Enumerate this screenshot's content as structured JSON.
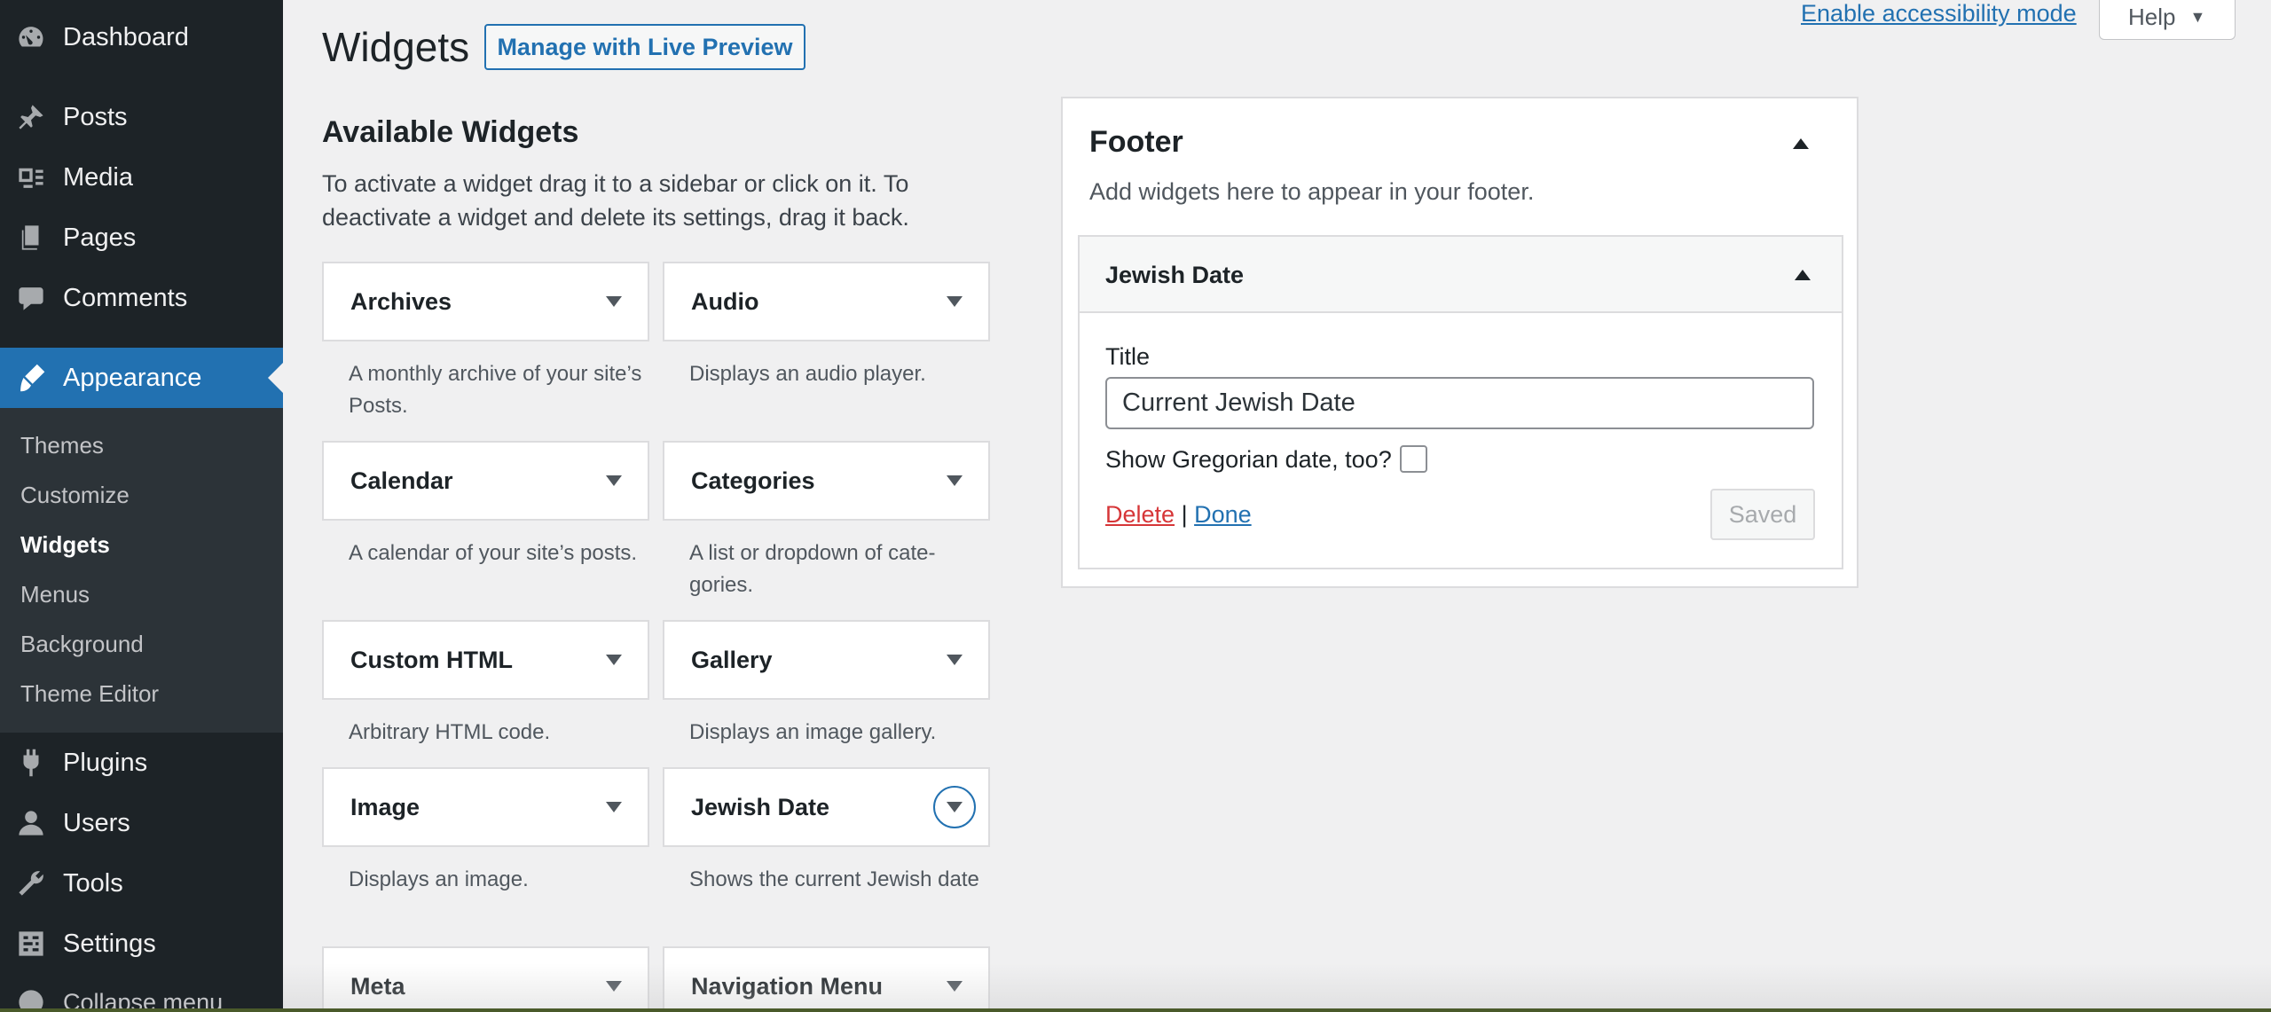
{
  "sidebar": {
    "items": [
      {
        "label": "Dashboard",
        "icon": "dashboard-icon"
      },
      {
        "label": "Posts",
        "icon": "pin-icon"
      },
      {
        "label": "Media",
        "icon": "media-icon"
      },
      {
        "label": "Pages",
        "icon": "pages-icon"
      },
      {
        "label": "Comments",
        "icon": "comments-icon"
      },
      {
        "label": "Appearance",
        "icon": "brush-icon"
      },
      {
        "label": "Plugins",
        "icon": "plugin-icon"
      },
      {
        "label": "Users",
        "icon": "users-icon"
      },
      {
        "label": "Tools",
        "icon": "wrench-icon"
      },
      {
        "label": "Settings",
        "icon": "settings-icon"
      },
      {
        "label": "Collapse menu",
        "icon": "collapse-icon"
      }
    ],
    "submenu": [
      "Themes",
      "Customize",
      "Widgets",
      "Menus",
      "Background",
      "Theme Editor"
    ],
    "current_submenu": "Widgets"
  },
  "header": {
    "title": "Widgets",
    "live_preview_label": "Manage with Live Preview",
    "accessibility_link": "Enable accessibility mode",
    "help_label": "Help"
  },
  "available": {
    "title": "Available Widgets",
    "description": "To activate a widget drag it to a sidebar or click on it. To deactivate a widget and delete its settings, drag it back.",
    "widgets": [
      {
        "title": "Archives",
        "desc": "A monthly archive of your site’s Posts."
      },
      {
        "title": "Audio",
        "desc": "Displays an audio player."
      },
      {
        "title": "Calendar",
        "desc": "A calendar of your site’s posts."
      },
      {
        "title": "Categories",
        "desc": "A list or dropdown of cate­gories."
      },
      {
        "title": "Custom HTML",
        "desc": "Arbitrary HTML code."
      },
      {
        "title": "Gallery",
        "desc": "Displays an image gallery."
      },
      {
        "title": "Image",
        "desc": "Displays an image."
      },
      {
        "title": "Jewish Date",
        "desc": "Shows the current Jewish date"
      },
      {
        "title": "Meta",
        "desc": ""
      },
      {
        "title": "Navigation Menu",
        "desc": ""
      }
    ]
  },
  "footer": {
    "title": "Footer",
    "description": "Add widgets here to appear in your footer.",
    "widget": {
      "title": "Jewish Date",
      "title_label": "Title",
      "title_value": "Current Jewish Date",
      "gregorian_label": "Show Gregorian date, too?",
      "delete_label": "Delete",
      "separator": "|",
      "done_label": "Done",
      "saved_label": "Saved"
    }
  },
  "colors": {
    "sidebar_bg": "#1d2327",
    "accent": "#2271b1",
    "delete": "#d63638"
  }
}
